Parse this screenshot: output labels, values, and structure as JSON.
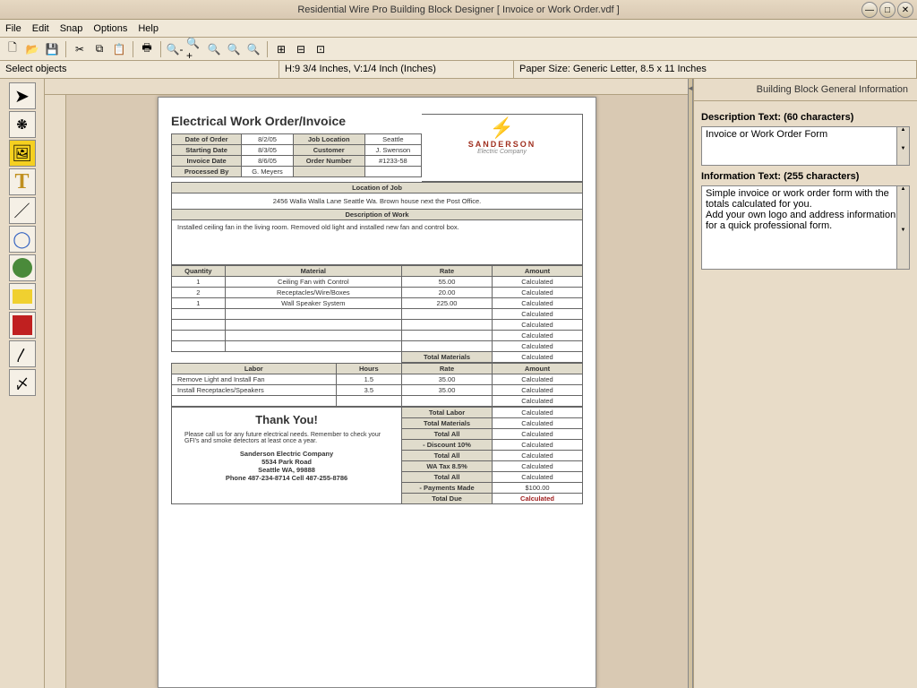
{
  "window": {
    "title": "Residential Wire Pro Building Block Designer [ Invoice or Work Order.vdf ]"
  },
  "menu": [
    "File",
    "Edit",
    "Snap",
    "Options",
    "Help"
  ],
  "infobar": {
    "selection": "Select objects",
    "position": "H:9 3/4 Inches, V:1/4 Inch (Inches)",
    "paper": "Paper Size: Generic Letter, 8.5 x 11 Inches"
  },
  "side": {
    "header": "Building Block General Information",
    "descLabel": "Description Text:  (60 characters)",
    "descValue": "Invoice or Work Order Form",
    "infoLabel": "Information Text:  (255 characters)",
    "infoValue": "Simple invoice or work order form with the totals calculated for you.\nAdd your own logo and address information for a quick professional form."
  },
  "doc": {
    "title": "Electrical Work Order/Invoice",
    "brand": "SANDERSON",
    "brandSub": "Electric Company",
    "headerRows": [
      [
        "Date of Order",
        "8/2/05",
        "Job Location",
        "Seattle"
      ],
      [
        "Starting Date",
        "8/3/05",
        "Customer",
        "J. Swenson"
      ],
      [
        "Invoice Date",
        "8/6/05",
        "Order Number",
        "#1233-58"
      ],
      [
        "Processed By",
        "G. Meyers",
        "",
        ""
      ]
    ],
    "locHeader": "Location of Job",
    "locText": "2456 Walla Walla Lane Seattle Wa.  Brown house next the Post Office.",
    "dowHeader": "Description of Work",
    "dowText": "Installed ceiling fan in the living room.  Removed old light and installed new fan and control box.",
    "matHeaders": [
      "Quantity",
      "Material",
      "Rate",
      "Amount"
    ],
    "materials": [
      [
        "1",
        "Ceiling Fan with Control",
        "55.00",
        "Calculated"
      ],
      [
        "2",
        "Receptacles/Wire/Boxes",
        "20.00",
        "Calculated"
      ],
      [
        "1",
        "Wall Speaker System",
        "225.00",
        "Calculated"
      ],
      [
        "",
        "",
        "",
        "Calculated"
      ],
      [
        "",
        "",
        "",
        "Calculated"
      ],
      [
        "",
        "",
        "",
        "Calculated"
      ],
      [
        "",
        "",
        "",
        "Calculated"
      ]
    ],
    "totMatLabel": "Total Materials",
    "totMatVal": "Calculated",
    "laborHeaders": [
      "Labor",
      "Hours",
      "Rate",
      "Amount"
    ],
    "labor": [
      [
        "Remove Light and Install Fan",
        "1.5",
        "35.00",
        "Calculated"
      ],
      [
        "Install Receptacles/Speakers",
        "3.5",
        "35.00",
        "Calculated"
      ],
      [
        "",
        "",
        "",
        "Calculated"
      ]
    ],
    "thank": "Thank You!",
    "note": "Please call us for any future electrical needs. Remember to check your GFI's and smoke detectors at least once a year.",
    "company": "Sanderson Electric Company",
    "addr1": "5534 Park Road",
    "addr2": "Seattle WA, 99888",
    "phone": "Phone 487-234-8714  Cell 487-255-8786",
    "summary": [
      [
        "Total Labor",
        "Calculated"
      ],
      [
        "Total Materials",
        "Calculated"
      ],
      [
        "Total All",
        "Calculated"
      ],
      [
        "- Discount 10%",
        "Calculated"
      ],
      [
        "Total All",
        "Calculated"
      ],
      [
        "WA Tax 8.5%",
        "Calculated"
      ],
      [
        "Total All",
        "Calculated"
      ],
      [
        "- Payments Made",
        "$100.00"
      ]
    ],
    "totalDueLabel": "Total Due",
    "totalDueVal": "Calculated"
  }
}
